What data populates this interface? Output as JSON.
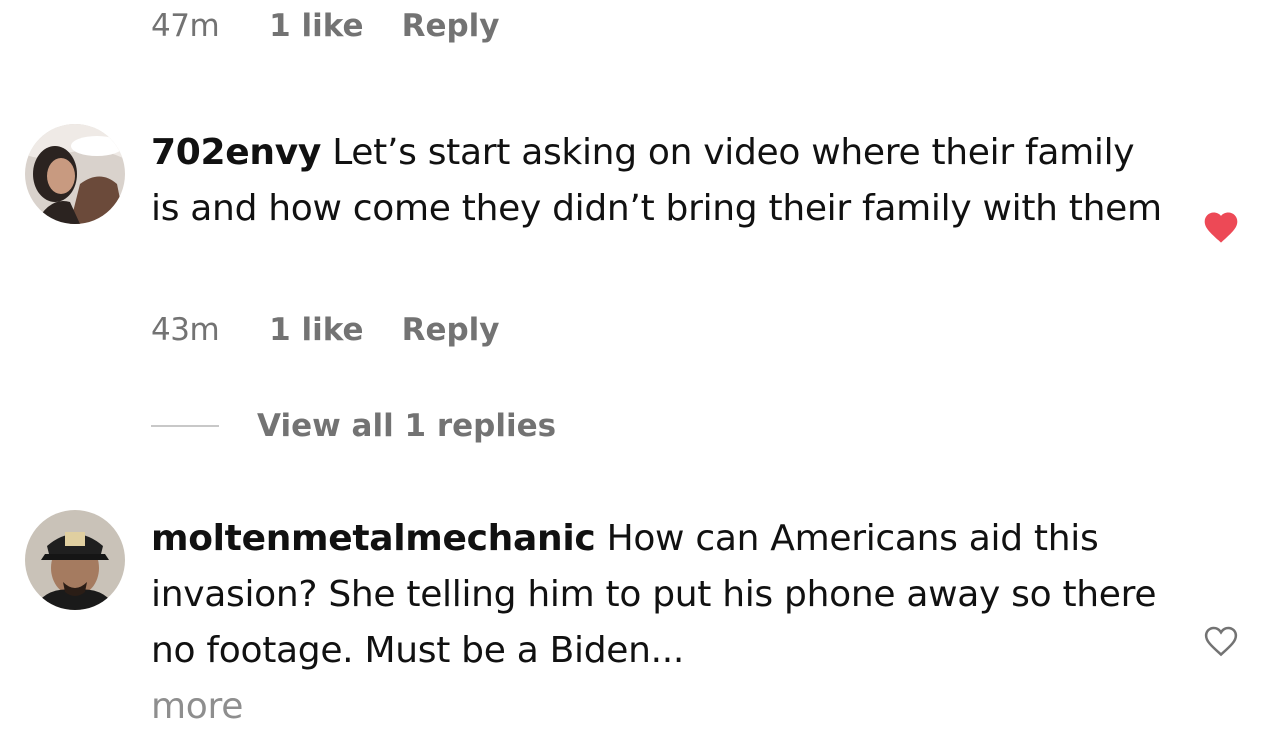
{
  "comments": [
    {
      "time": "47m",
      "likes": "1 like",
      "reply": "Reply"
    },
    {
      "username": "702envy",
      "text": "Let’s start asking on video where their family is and how come they didn’t bring their family with them",
      "time": "43m",
      "likes": "1 like",
      "reply": "Reply",
      "liked": true,
      "view_replies": "View all 1 replies"
    },
    {
      "username": "moltenmetalmechanic",
      "text": "How can Americans aid this invasion? She telling him to put his phone away so there no footage. Must be a Biden...",
      "more": "more",
      "liked": false
    }
  ],
  "colors": {
    "heart_liked": "#ed4956",
    "meta_text": "#737373"
  },
  "icons": {
    "liked": "heart-filled-icon",
    "unliked": "heart-outline-icon"
  }
}
